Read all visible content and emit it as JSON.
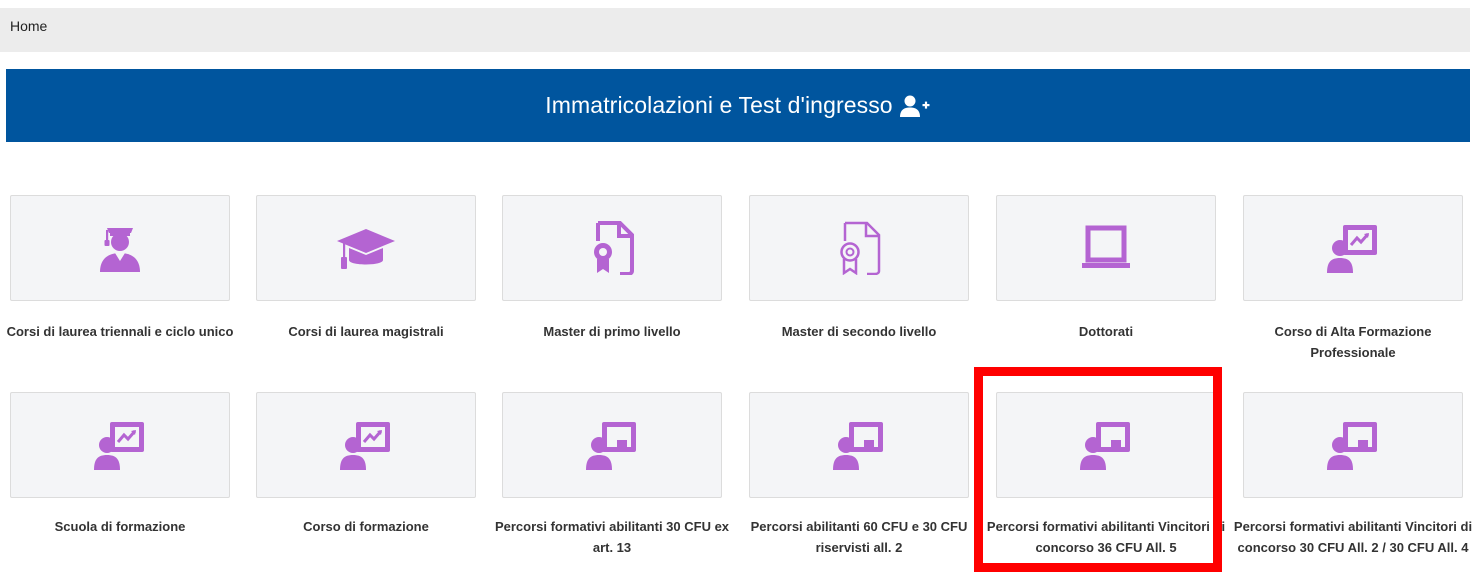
{
  "breadcrumb": {
    "home": "Home"
  },
  "banner": {
    "title": "Immatricolazioni e Test d'ingresso",
    "icon": "add-user-icon"
  },
  "colors": {
    "banner": "#00559e",
    "icon": "#b464d2",
    "highlight": "#ff0000",
    "tile_bg": "#f4f5f7"
  },
  "tiles": [
    {
      "label": "Corsi di laurea triennali e ciclo unico",
      "icon": "student-icon"
    },
    {
      "label": "Corsi di laurea magistrali",
      "icon": "graduation-cap-icon"
    },
    {
      "label": "Master di primo livello",
      "icon": "certificate-icon"
    },
    {
      "label": "Master di secondo livello",
      "icon": "certificate-outline-icon"
    },
    {
      "label": "Dottorati",
      "icon": "laptop-icon"
    },
    {
      "label": "Corso di Alta Formazione Professionale",
      "icon": "presentation-chart-icon"
    },
    {
      "label": "Scuola di formazione",
      "icon": "presentation-chart-icon"
    },
    {
      "label": "Corso di formazione",
      "icon": "presentation-chart-icon"
    },
    {
      "label": "Percorsi formativi abilitanti 30 CFU ex art. 13",
      "icon": "teacher-board-icon"
    },
    {
      "label": "Percorsi abilitanti 60 CFU e 30 CFU riservisti all. 2",
      "icon": "teacher-board-icon"
    },
    {
      "label": "Percorsi formativi abilitanti Vincitori di concorso 36 CFU All. 5",
      "icon": "teacher-board-icon"
    },
    {
      "label": "Percorsi formativi abilitanti Vincitori di concorso 30 CFU All. 2 / 30 CFU All. 4",
      "icon": "teacher-board-icon"
    }
  ]
}
